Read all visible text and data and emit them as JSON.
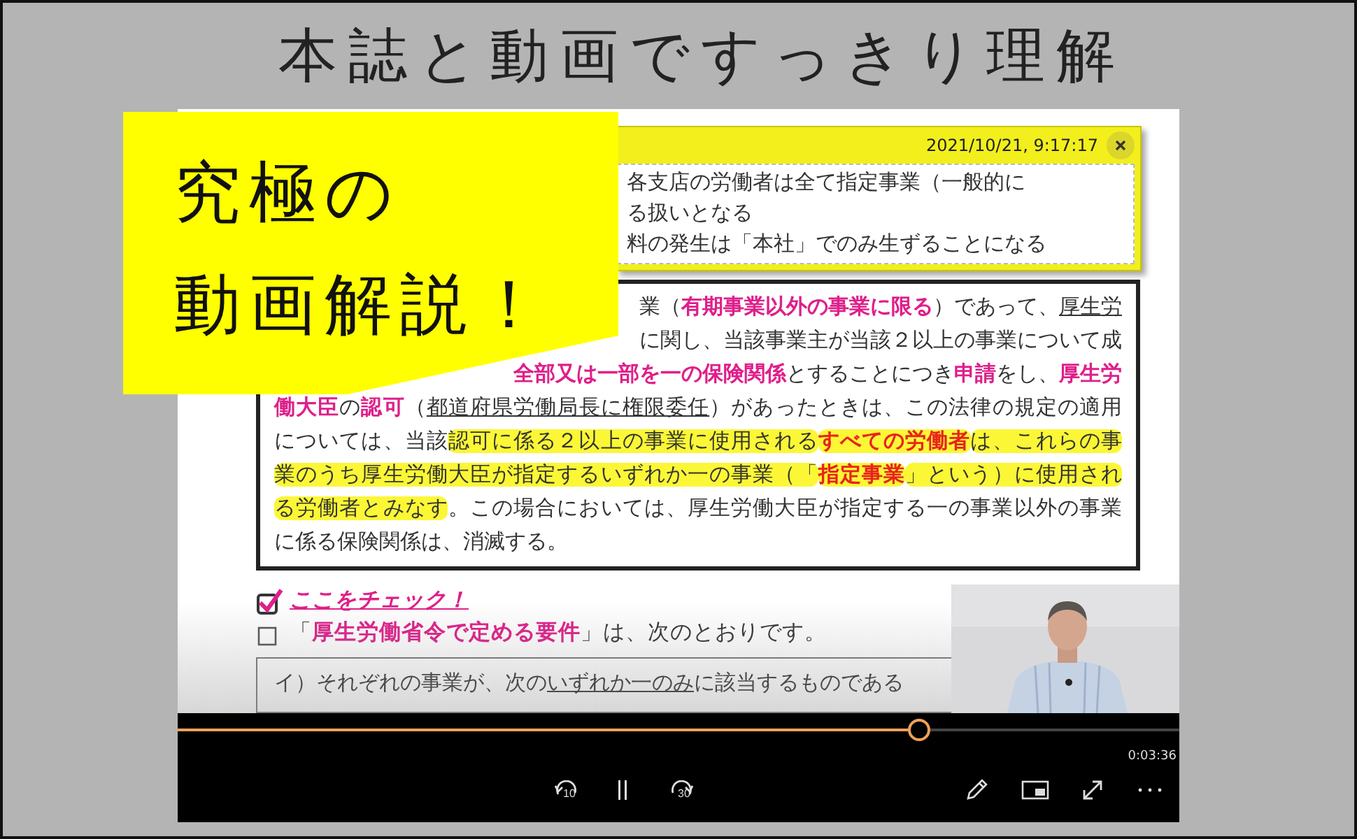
{
  "title": "本誌と動画ですっきり理解",
  "promo_note": {
    "lines": [
      "究極の",
      "動画解説！"
    ]
  },
  "annotation": {
    "timestamp": "2021/10/21, 9:17:17",
    "lines": [
      "各支店の労働者は全て指定事業（一般的に",
      "る扱いとなる",
      "料の発生は「本社」でのみ生ずることになる"
    ]
  },
  "document": {
    "box_lines": [
      {
        "kind": "cut",
        "segments": [
          {
            "text": "業（",
            "kind": "plain",
            "highlighted": false
          },
          {
            "text": "有期事業以外の事業に限る",
            "kind": "pink",
            "highlighted": false
          },
          {
            "text": "）であって、",
            "kind": "plain",
            "highlighted": false
          },
          {
            "text": "厚生労",
            "kind": "underline",
            "highlighted": false
          }
        ]
      },
      {
        "kind": "cut",
        "segments": [
          {
            "text": "に関し、当該事業主が当該２以上の事業について成",
            "kind": "plain",
            "highlighted": false
          }
        ]
      },
      {
        "kind": "cut",
        "segments": [
          {
            "text": "全部又は一部を一の保険関係",
            "kind": "pink",
            "highlighted": false
          },
          {
            "text": "とすることにつき",
            "kind": "plain",
            "highlighted": false
          },
          {
            "text": "申請",
            "kind": "pink",
            "highlighted": false
          },
          {
            "text": "をし、",
            "kind": "plain",
            "highlighted": false
          },
          {
            "text": "厚生労",
            "kind": "pink",
            "highlighted": false
          }
        ]
      },
      {
        "kind": "full",
        "segments": [
          {
            "text": "働大臣",
            "kind": "pink",
            "highlighted": false
          },
          {
            "text": "の",
            "kind": "plain",
            "highlighted": false
          },
          {
            "text": "認可",
            "kind": "pink",
            "highlighted": false
          },
          {
            "text": "（",
            "kind": "plain",
            "highlighted": false
          },
          {
            "text": "都道府県労働局長に権限委任",
            "kind": "underline",
            "highlighted": false
          },
          {
            "text": "）があったときは、この法律の規定の適用",
            "kind": "plain",
            "highlighted": false
          }
        ]
      },
      {
        "kind": "full",
        "segments": [
          {
            "text": "については、当該",
            "kind": "plain",
            "highlighted": false
          },
          {
            "text": "認可に係る２以上の事業に使用される",
            "kind": "plain",
            "highlighted": true
          },
          {
            "text": "すべての労働者",
            "kind": "red",
            "highlighted": true
          },
          {
            "text": "は、これらの事",
            "kind": "plain",
            "highlighted": true
          }
        ]
      },
      {
        "kind": "full",
        "segments": [
          {
            "text": "業のうち厚生労働大臣が指定するいずれか一の事業（「",
            "kind": "plain",
            "highlighted": true
          },
          {
            "text": "指定事業",
            "kind": "red",
            "highlighted": true
          },
          {
            "text": "」という）に使用され",
            "kind": "plain",
            "highlighted": true
          }
        ]
      },
      {
        "kind": "full",
        "segments": [
          {
            "text": "る労働者とみなす",
            "kind": "plain",
            "highlighted": true
          },
          {
            "text": "。この場合においては、厚生労働大臣が指定する一の事業以外の事業",
            "kind": "plain",
            "highlighted": false
          }
        ]
      },
      {
        "kind": "last",
        "segments": [
          {
            "text": "に係る保険関係は、消滅する。",
            "kind": "plain",
            "highlighted": false
          }
        ]
      }
    ],
    "check_items": [
      {
        "checked": true,
        "segments": [
          {
            "text": "ここをチェック！",
            "kind": "heading",
            "highlighted": false
          }
        ]
      },
      {
        "checked": false,
        "segments": [
          {
            "text": "「",
            "kind": "plain",
            "highlighted": false
          },
          {
            "text": "厚生労働省令で定める要件",
            "kind": "pink",
            "highlighted": false
          },
          {
            "text": "」は、次のとおりです。",
            "kind": "plain",
            "highlighted": false
          }
        ]
      }
    ],
    "framed_line": {
      "segments": [
        {
          "text": "イ）それぞれの事業が、次の",
          "kind": "plain",
          "highlighted": false
        },
        {
          "text": "いずれか一のみ",
          "kind": "underline",
          "highlighted": false
        },
        {
          "text": "に該当するものである",
          "kind": "plain",
          "highlighted": false
        }
      ]
    }
  },
  "player": {
    "progress": {
      "level": 0.74
    },
    "time": "0:03:36",
    "controls": [
      {
        "kind": "rewind",
        "label": "10"
      },
      {
        "kind": "pause"
      },
      {
        "kind": "forward",
        "label": "30"
      },
      {
        "kind": "pen"
      },
      {
        "kind": "miniview"
      },
      {
        "kind": "fullscreen"
      },
      {
        "kind": "more"
      }
    ]
  }
}
